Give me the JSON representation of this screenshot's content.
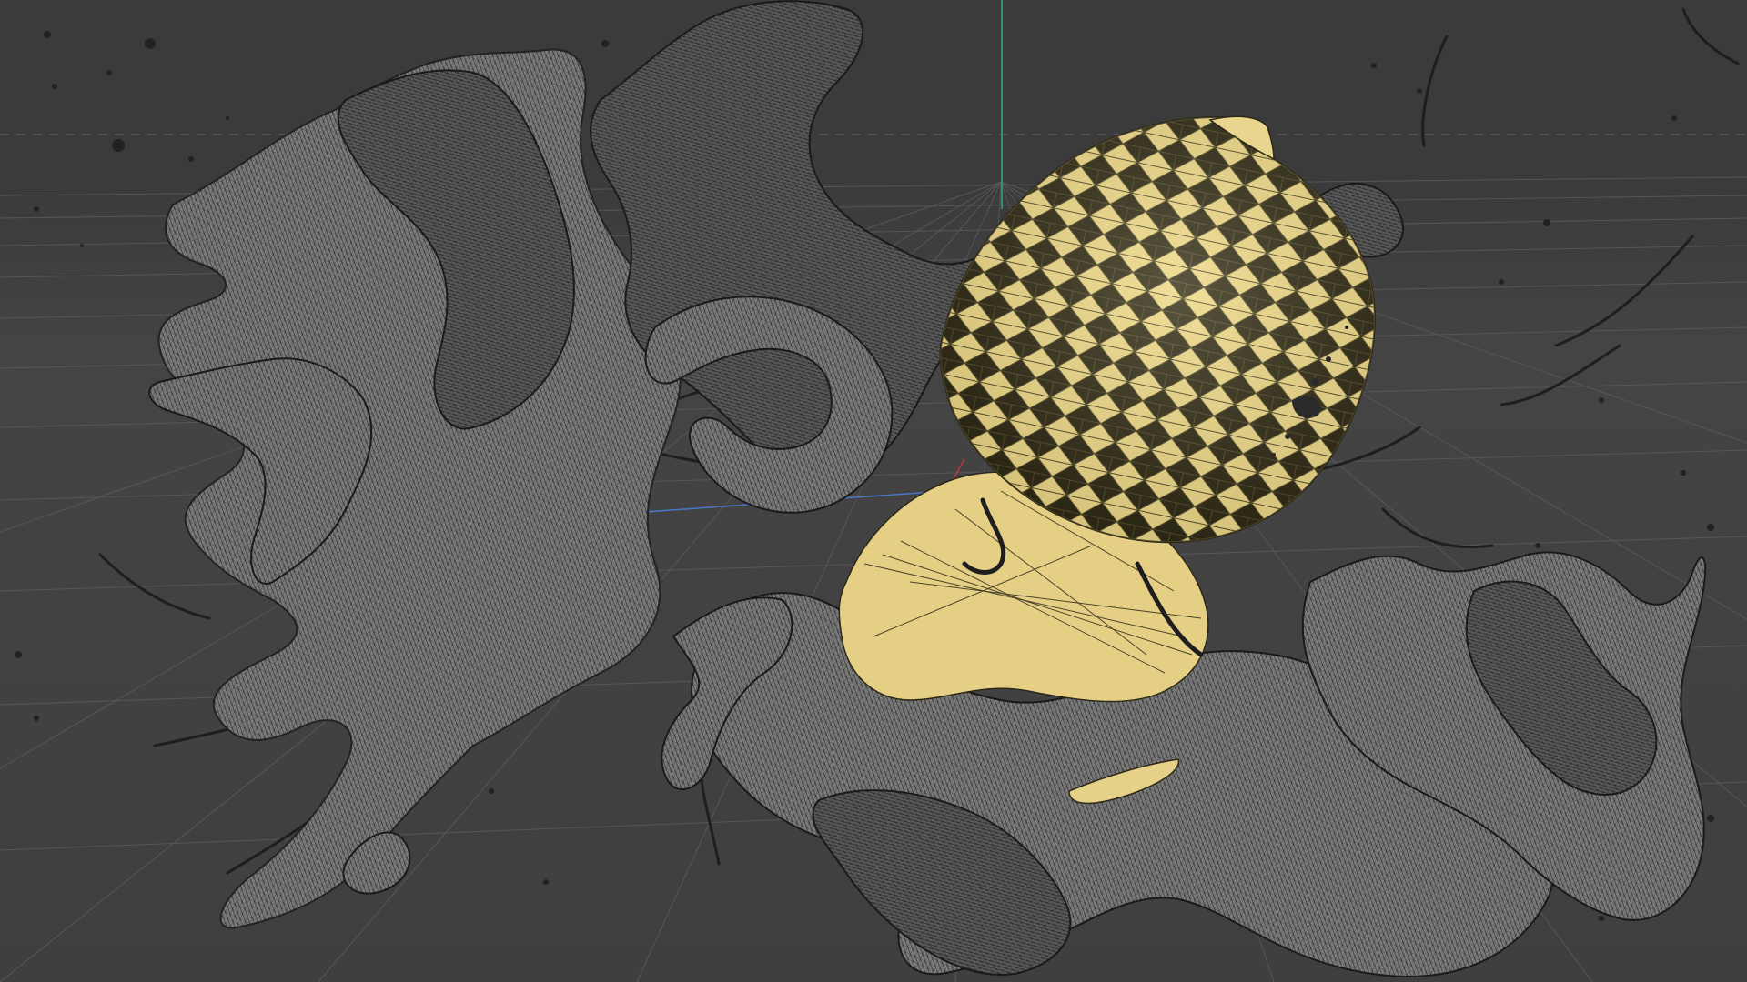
{
  "viewport": {
    "background_color": "#3b3b3b",
    "floor_color": "#474747",
    "grid_line_color": "#5a5a5a",
    "horizon_dashed_color": "#6a6a6a",
    "y_axis_color": "#2fae7a",
    "x_axis_color": "#c0344a",
    "z_axis_color": "#4a78c8"
  },
  "scene_objects": [
    {
      "name": "fluid-splash-mesh",
      "shading": "wireframe-on-shaded",
      "base_color": "#7d7d7d",
      "wire_color": "#1e1e1e"
    },
    {
      "name": "lemon-mesh",
      "shading": "wireframe-on-shaded",
      "base_color": "#e7d38a",
      "wire_color": "#2a2718"
    },
    {
      "name": "lemon-slice-mesh",
      "shading": "shaded",
      "base_color": "#e4cf85"
    },
    {
      "name": "lemon-wedge-mesh",
      "shading": "shaded",
      "base_color": "#e6d188"
    }
  ]
}
